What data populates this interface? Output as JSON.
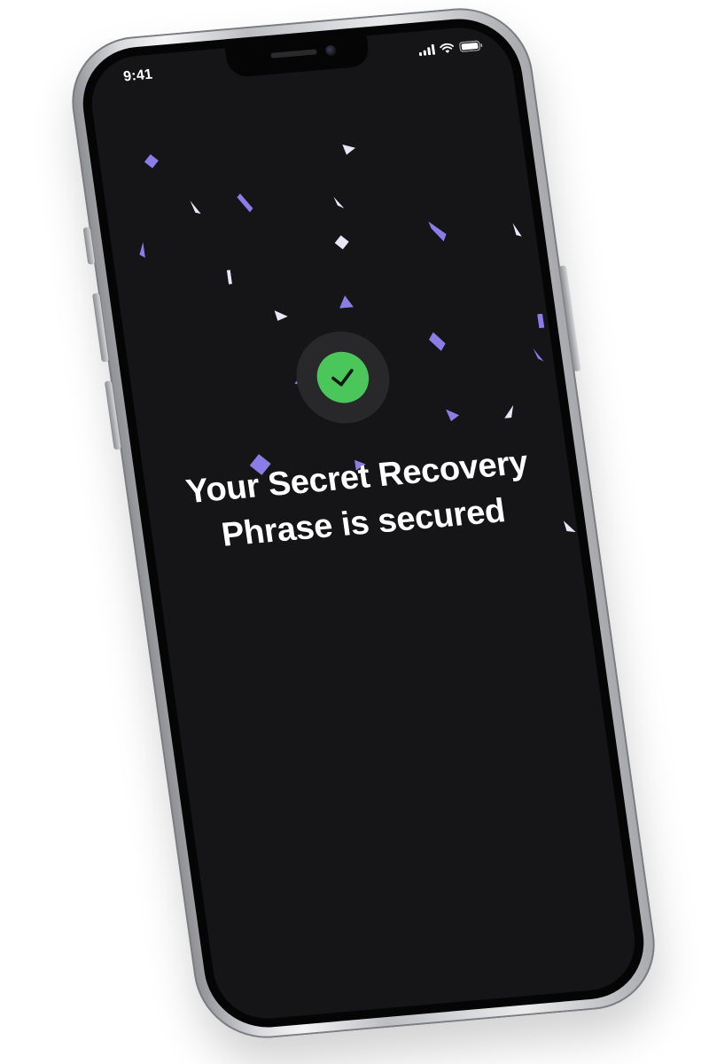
{
  "status_bar": {
    "time": "9:41",
    "icons": [
      "signal-icon",
      "wifi-icon",
      "battery-icon"
    ]
  },
  "success": {
    "icon": "check-icon",
    "title": "Your Secret Recovery Phrase is secured"
  },
  "colors": {
    "screen_background": "#151517",
    "check_green": "#4bc65b",
    "confetti_purple": "#8a7de8",
    "confetti_light": "#e8e6f7"
  }
}
